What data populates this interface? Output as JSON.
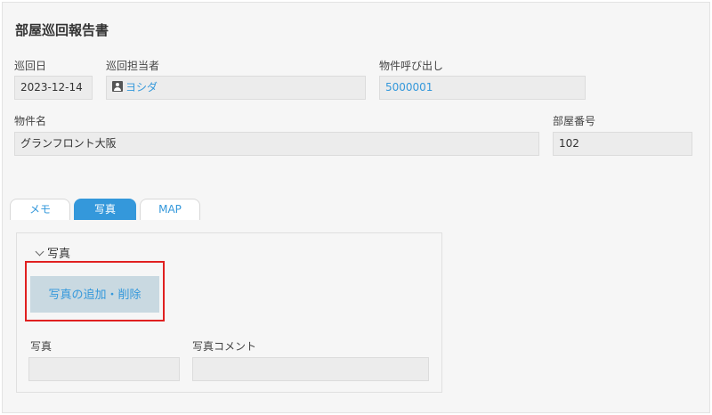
{
  "form": {
    "title": "部屋巡回報告書"
  },
  "fields": {
    "patrol_date": {
      "label": "巡回日",
      "value": "2023-12-14"
    },
    "patrol_staff": {
      "label": "巡回担当者",
      "value": "ヨシダ",
      "icon": "user-icon"
    },
    "property_lookup": {
      "label": "物件呼び出し",
      "value": "5000001"
    },
    "property_name": {
      "label": "物件名",
      "value": "グランフロント大阪"
    },
    "room_number": {
      "label": "部屋番号",
      "value": "102"
    }
  },
  "tabs": [
    {
      "label": "メモ",
      "active": false
    },
    {
      "label": "写真",
      "active": true
    },
    {
      "label": "MAP",
      "active": false
    }
  ],
  "photo_section": {
    "header": "写真",
    "add_button": "写真の追加・削除",
    "photo_label": "写真",
    "comment_label": "写真コメント",
    "photo_value": "",
    "comment_value": ""
  },
  "colors": {
    "accent": "#3498db",
    "highlight_border": "#e02020",
    "button_bg": "#c9d9e1"
  }
}
